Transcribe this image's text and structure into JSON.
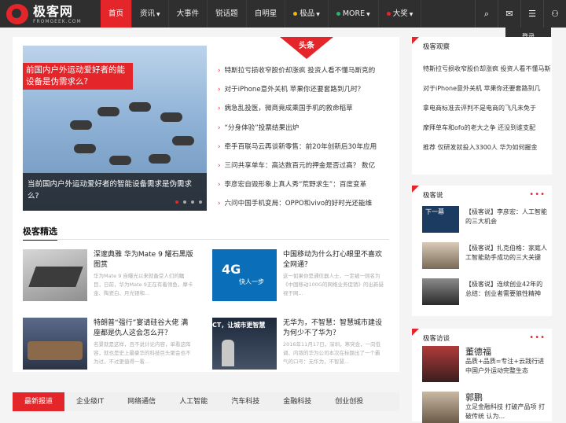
{
  "site": {
    "logo_cn": "极客网",
    "logo_en": "FROMGEEK.COM"
  },
  "nav": [
    {
      "label": "首页",
      "active": true
    },
    {
      "label": "资讯",
      "caret": true
    },
    {
      "label": "大事件"
    },
    {
      "label": "锐话题"
    },
    {
      "label": "自明星"
    },
    {
      "label": "极品",
      "caret": true,
      "dot": "#f5b400"
    },
    {
      "label": "MORE",
      "caret": true,
      "dot": "#27b36f"
    },
    {
      "label": "大奖",
      "caret": true,
      "dot": "#e4262b"
    }
  ],
  "tools": {
    "search_icon": "⌕",
    "wechat_icon": "✉",
    "menu_icon": "☰",
    "user_icon": "⚇"
  },
  "user_menu": {
    "login": "登录",
    "register": "注册"
  },
  "headline": {
    "tag": "头条",
    "slide_title": "前国内户外运动爱好者的能设备是伪需求么?",
    "slide_caption": "当前国内户外运动爱好者的智能设备需求是伪需求么?",
    "news": [
      "特斯拉亏损收窄股价却涨疯 投资人看不懂马斯克的",
      "对于iPhone意外关机 苹果你还要套路到几时？",
      "病急乱投医，微商竟成乘国手机的救命稻草",
      "“分身体验”投票结果出炉",
      "牵手百联马云再谈新零售：前20年创新后30年应用",
      "三问共享单车：高达数百元的押金是否过高？ 数亿",
      "李彦宏自毁形象上真人秀“荒野求生”：百度变革",
      "六问中国手机变局：OPPO和vivo的好时光还能维"
    ]
  },
  "picks": {
    "title": "极客精选",
    "items": [
      {
        "title": "深邃典雅 华为Mate 9 耀石黑版图赏",
        "desc": "华为Mate 9 自曝光以来就备受人们的瞩目，日前，华为Mate 9正在有着领鱼，摩卡金、陶瓷白、月光银和..."
      },
      {
        "title": "中国移动为什么打心眼里不喜欢全网通？",
        "desc": "这一如果你是通信器人士，一定被一则名为《中国移动100G的网络业务促销》的出新疑视于网..."
      },
      {
        "title": "特朗普“强行”宴请硅谷大佬 满座都是仇人这会怎么开？",
        "desc": "名景就是这样，且不说计论内容，单看这阵容，就也是史上最豪华的科技巨头聚会也不为过，不过更值得一看..."
      },
      {
        "title": "无华为，不智慧：智慧城市建设为何少不了华为？",
        "desc": "2016年11月17日，深圳，寒突会，一向低调、内敛的华为公司本次在标题出了一个霸气的口号：无华为，不智慧..."
      }
    ],
    "thumb_text_4g": "4G",
    "thumb_text_4g_sub": "快人一步",
    "thumb_text_ct": "CT，让城市更智慧"
  },
  "tabs": [
    "最新报道",
    "企业级IT",
    "网络通信",
    "人工智能",
    "汽车科技",
    "金融科技",
    "创业创投"
  ],
  "sidebar": {
    "observe": {
      "title": "极客观察",
      "items": [
        "特斯拉亏损收窄股价却涨疯 投资人看不懂马斯",
        "对于iPhone意外关机 苹果你还要套路到几",
        "拿电商标准去评判不是电商的飞凡未免于",
        "摩拜单车和ofo的老大之争 还没到谁支配",
        "推荐 仅研发就投入3300人 华为如何握金"
      ]
    },
    "talk": {
      "title": "极客说",
      "more": "•••",
      "items": [
        "【极客说】李彦宏：人工智能的三大机会",
        "【极客说】扎克伯格：家庭人工智能助手成功的三大关键",
        "【极客说】连续创业42年的总结：创业者需要狼性精神"
      ],
      "img1_text": "下一幕"
    },
    "interview": {
      "title": "极客访谈",
      "more": "•••",
      "people": [
        {
          "name": "董德福",
          "desc": "品质+品质=专注+云践行进中国户外运动完整生态"
        },
        {
          "name": "郭鹏",
          "desc": "立足金融科技 打破产品项 打破传统 认为..."
        }
      ]
    }
  }
}
